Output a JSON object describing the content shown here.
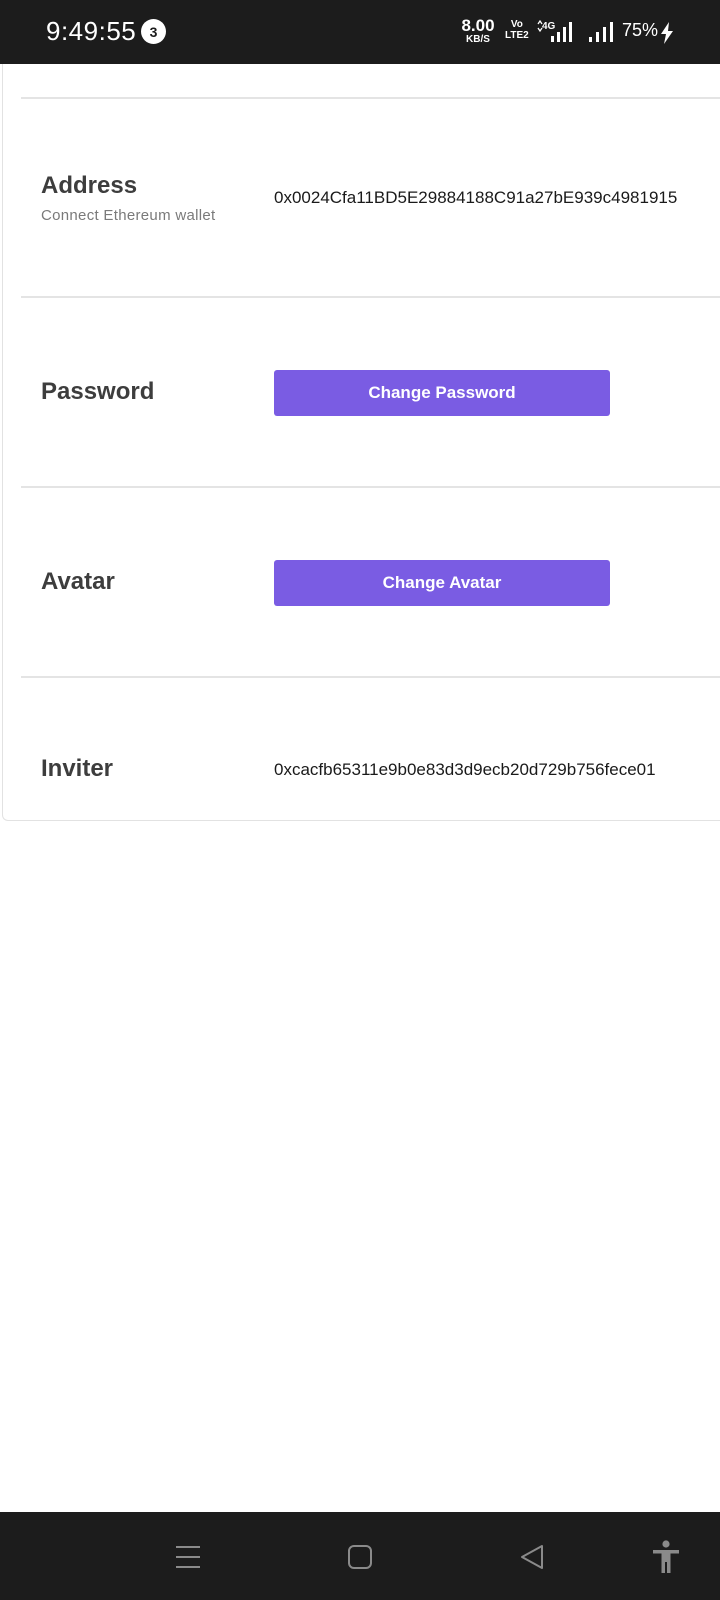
{
  "status_bar": {
    "time": "9:49:55",
    "notification_count": "3",
    "net_speed_value": "8.00",
    "net_speed_unit": "KB/S",
    "volte_top": "Vo",
    "volte_bottom": "LTE2",
    "network_type": "4G",
    "battery_percent": "75%"
  },
  "settings": {
    "address": {
      "label": "Address",
      "sublabel": "Connect Ethereum wallet",
      "value": "0x0024Cfa11BD5E29884188C91a27bE939c4981915"
    },
    "password": {
      "label": "Password",
      "button_label": "Change Password"
    },
    "avatar": {
      "label": "Avatar",
      "button_label": "Change Avatar"
    },
    "inviter": {
      "label": "Inviter",
      "value": "0xcacfb65311e9b0e83d3d9ecb20d729b756fece01"
    }
  },
  "colors": {
    "accent": "#7a5ce3",
    "system_bar": "#1c1c1c"
  },
  "icons": {
    "nav": [
      "menu-icon",
      "home-icon",
      "back-icon",
      "accessibility-icon"
    ],
    "status": [
      "signal-4g-icon",
      "signal-icon",
      "charging-icon"
    ]
  }
}
